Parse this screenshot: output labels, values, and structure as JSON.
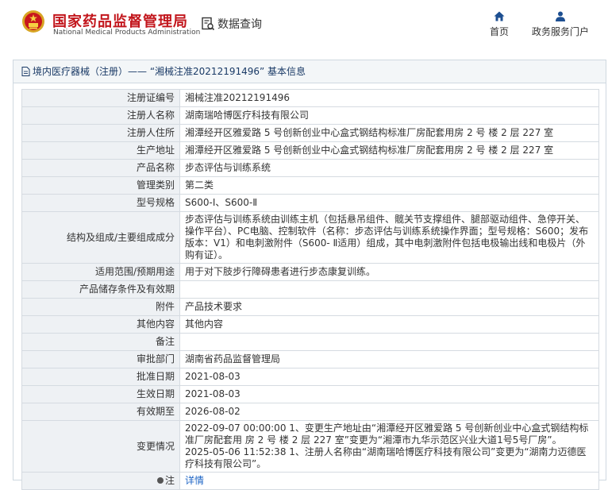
{
  "header": {
    "brand_cn": "国家药品监督管理局",
    "brand_en": "National Medical Products Administration",
    "data_query": "数据查询",
    "nav": {
      "home": "首页",
      "portal": "政务服务门户"
    },
    "brand_color": "#c2161c",
    "icons": {
      "emblem": "national-emblem-icon",
      "query": "data-query-icon",
      "home": "home-icon",
      "portal": "user-icon"
    }
  },
  "panel": {
    "title": "境内医疗器械（注册）—— “湘械注准20212191496” 基本信息"
  },
  "fields": [
    {
      "label": "注册证编号",
      "value": "湘械注准20212191496"
    },
    {
      "label": "注册人名称",
      "value": "湖南瑞哈博医疗科技有限公司"
    },
    {
      "label": "注册人住所",
      "value": "湘潭经开区雅爱路 5 号创新创业中心盒式钢结构标准厂房配套用房 2 号 楼 2 层 227 室"
    },
    {
      "label": "生产地址",
      "value": "湘潭经开区雅爱路 5 号创新创业中心盒式钢结构标准厂房配套用房 2 号 楼 2 层 227 室"
    },
    {
      "label": "产品名称",
      "value": "步态评估与训练系统"
    },
    {
      "label": "管理类别",
      "value": "第二类"
    },
    {
      "label": "型号规格",
      "value": "S600-Ⅰ、S600-Ⅱ"
    },
    {
      "label": "结构及组成/主要组成成分",
      "value": "步态评估与训练系统由训练主机（包括悬吊组件、髋关节支撑组件、腿部驱动组件、急停开关、操作平台）、PC电脑、控制软件（名称：步态评估与训练系统操作界面；型号规格：S600；发布版本：V1）和电刺激附件（S600- Ⅱ适用）组成，其中电刺激附件包括电极输出线和电极片（外购有证）。"
    },
    {
      "label": "适用范围/预期用途",
      "value": "用于对下肢步行障碍患者进行步态康复训练。"
    },
    {
      "label": "产品储存条件及有效期",
      "value": ""
    },
    {
      "label": "附件",
      "value": "产品技术要求"
    },
    {
      "label": "其他内容",
      "value": "其他内容"
    },
    {
      "label": "备注",
      "value": ""
    },
    {
      "label": "审批部门",
      "value": "湖南省药品监督管理局"
    },
    {
      "label": "批准日期",
      "value": "2021-08-03"
    },
    {
      "label": "生效日期",
      "value": "2021-08-03"
    },
    {
      "label": "有效期至",
      "value": "2026-08-02"
    },
    {
      "label": "变更情况",
      "value": "2022-09-07 00:00:00 1、变更生产地址由“湘潭经开区雅爱路 5 号创新创业中心盒式钢结构标准厂房配套用 房 2 号 楼 2 层 227 室”变更为“湘潭市九华示范区兴业大道1号5号厂房”。\n2025-05-06 11:52:38 1、注册人名称由“湖南瑞哈博医疗科技有限公司”变更为“湖南力迈德医疗科技有限公司”。"
    }
  ],
  "note_row": {
    "label": "注",
    "link": "详情"
  }
}
